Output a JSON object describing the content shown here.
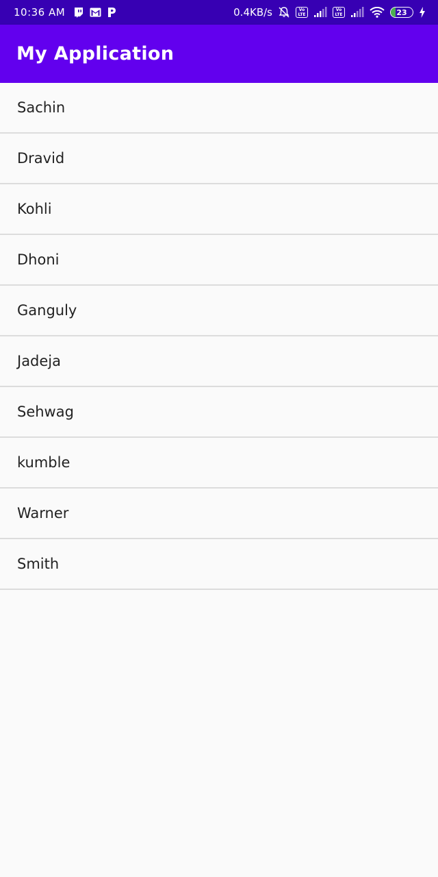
{
  "status_bar": {
    "time": "10:36 AM",
    "net_speed": "0.4KB/s",
    "volte_label": "Vo LTE",
    "battery_level": "23",
    "battery_fraction": 0.23,
    "left_icons": [
      "twitch-icon",
      "gmail-icon",
      "paytm-icon"
    ],
    "right_icons": [
      "mute-bell-icon",
      "volte-icon",
      "signal-icon",
      "volte-icon",
      "signal-icon",
      "wifi-icon",
      "battery-icon",
      "charging-icon"
    ]
  },
  "app_bar": {
    "title": "My Application"
  },
  "list": {
    "items": [
      {
        "label": "Sachin"
      },
      {
        "label": "Dravid"
      },
      {
        "label": "Kohli"
      },
      {
        "label": "Dhoni"
      },
      {
        "label": "Ganguly"
      },
      {
        "label": "Jadeja"
      },
      {
        "label": "Sehwag"
      },
      {
        "label": "kumble"
      },
      {
        "label": "Warner"
      },
      {
        "label": "Smith"
      }
    ]
  },
  "colors": {
    "status_bar": "#3700b3",
    "app_bar": "#6200ee",
    "background": "#fafafa",
    "divider": "#dcdcdc",
    "text": "#222222",
    "battery_fill": "#4caf50"
  }
}
